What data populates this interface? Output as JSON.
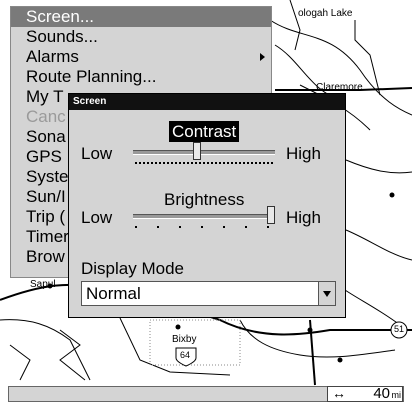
{
  "menu": {
    "items": [
      {
        "label": "Screen...",
        "selected": true,
        "disabled": false,
        "submenu": false
      },
      {
        "label": "Sounds...",
        "selected": false,
        "disabled": false,
        "submenu": false
      },
      {
        "label": "Alarms",
        "selected": false,
        "disabled": false,
        "submenu": true
      },
      {
        "label": "Route Planning...",
        "selected": false,
        "disabled": false,
        "submenu": false
      },
      {
        "label": "My T",
        "selected": false,
        "disabled": false,
        "submenu": false
      },
      {
        "label": "Canc",
        "selected": false,
        "disabled": true,
        "submenu": false
      },
      {
        "label": "Sona",
        "selected": false,
        "disabled": false,
        "submenu": false
      },
      {
        "label": "GPS",
        "selected": false,
        "disabled": false,
        "submenu": false
      },
      {
        "label": "Syste",
        "selected": false,
        "disabled": false,
        "submenu": false
      },
      {
        "label": "Sun/I",
        "selected": false,
        "disabled": false,
        "submenu": false
      },
      {
        "label": "Trip (",
        "selected": false,
        "disabled": false,
        "submenu": false
      },
      {
        "label": "Timer",
        "selected": false,
        "disabled": false,
        "submenu": false
      },
      {
        "label": "Brow",
        "selected": false,
        "disabled": false,
        "submenu": false
      }
    ]
  },
  "dialog": {
    "title": "Screen",
    "contrast": {
      "title": "Contrast",
      "low_label": "Low",
      "high_label": "High",
      "level": 0.45
    },
    "brightness": {
      "title": "Brightness",
      "low_label": "Low",
      "high_label": "High",
      "level": 1.0
    },
    "display_mode": {
      "label": "Display Mode",
      "value": "Normal"
    }
  },
  "map": {
    "labels": {
      "town_a": "ologah Lake",
      "town_b": "Claremore",
      "town_c": "Sapul",
      "town_d": "Bixby"
    },
    "shields": {
      "us_route": "64",
      "state_route": "51"
    }
  },
  "status": {
    "scale_arrow": "↔",
    "scale_value": "40",
    "scale_unit": "mi"
  }
}
